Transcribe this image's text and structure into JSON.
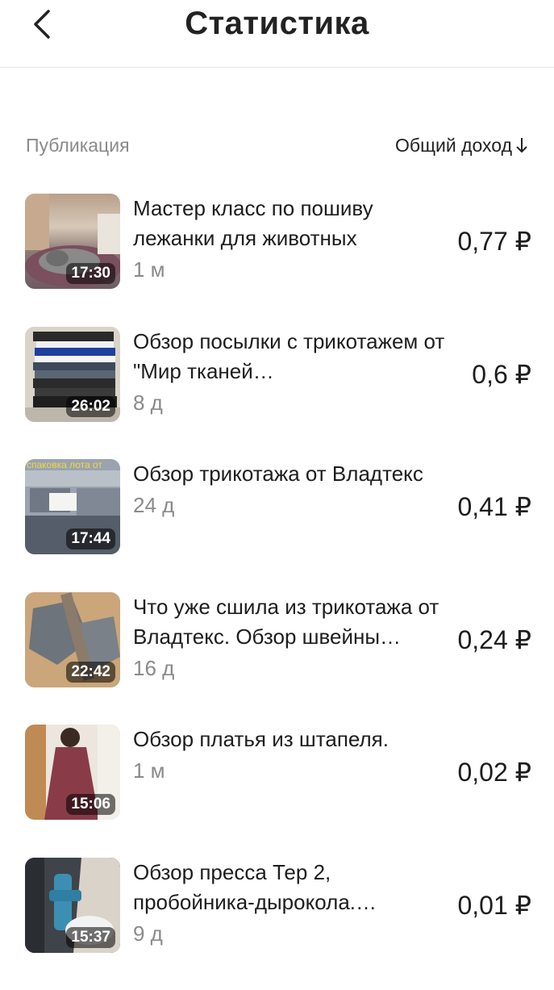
{
  "header": {
    "title": "Статистика"
  },
  "columns": {
    "left": "Публикация",
    "right": "Общий доход"
  },
  "items": [
    {
      "title": "Мастер класс по пошиву лежанки для животных",
      "duration": "17:30",
      "age": "1 м",
      "amount": "0,77 ₽"
    },
    {
      "title": "Обзор посылки с трикотажем от \"Мир тканей…",
      "duration": "26:02",
      "age": "8 д",
      "amount": "0,6 ₽"
    },
    {
      "title": "Обзор трикотажа от Владтекс",
      "duration": "17:44",
      "age": "24 д",
      "amount": "0,41 ₽",
      "thumb_text": "спаковка лота от"
    },
    {
      "title": "Что уже сшила из трикотажа от Владтекс. Обзор швейны…",
      "duration": "22:42",
      "age": "16 д",
      "amount": "0,24 ₽"
    },
    {
      "title": "Обзор платья из штапеля.",
      "duration": "15:06",
      "age": "1 м",
      "amount": "0,02 ₽"
    },
    {
      "title": "Обзор пресса Тер 2, пробойника-дырокола.…",
      "duration": "15:37",
      "age": "9 д",
      "amount": "0,01 ₽"
    }
  ],
  "icons": {
    "back": "chevron-left-icon",
    "sort": "arrow-down-icon"
  }
}
